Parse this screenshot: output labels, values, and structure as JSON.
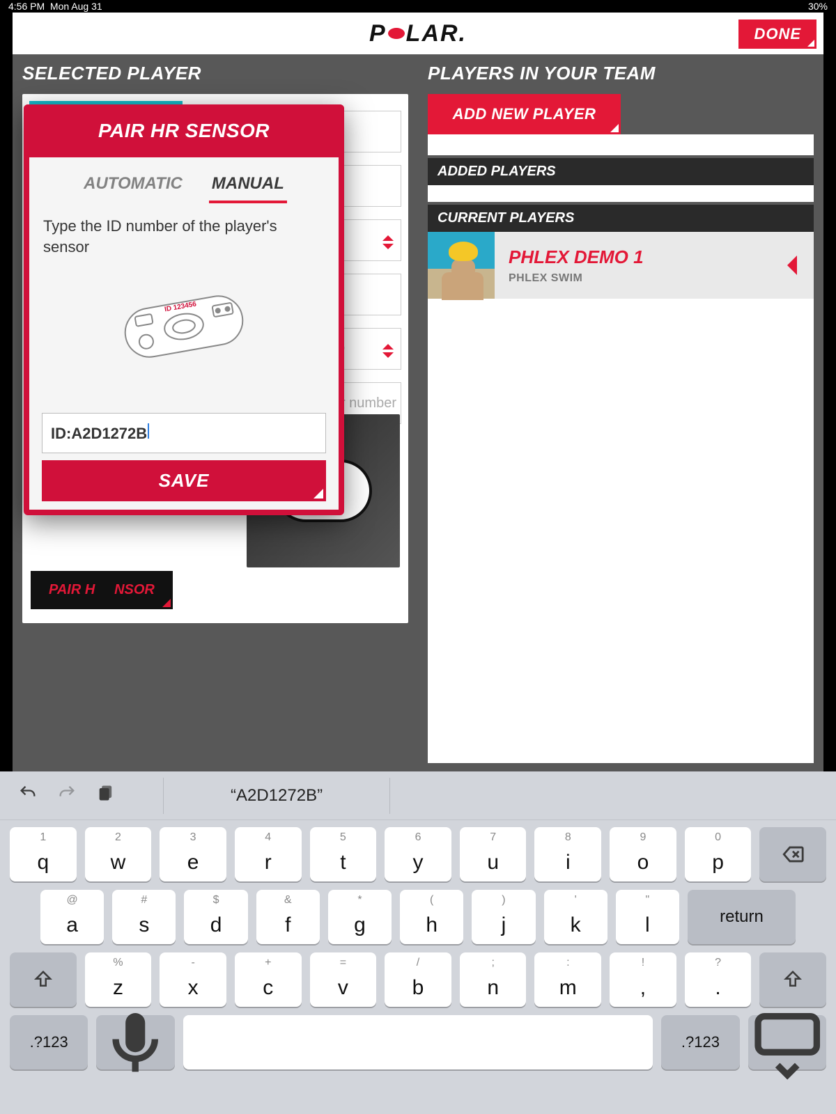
{
  "status": {
    "time": "4:56 PM",
    "date": "Mon Aug 31",
    "battery": "30%"
  },
  "brand": {
    "left": "P",
    "right": "LAR."
  },
  "done": "DONE",
  "left": {
    "title": "SELECTED PLAYER",
    "placeholder_number": "er number",
    "pair_button": "PAIR HR SENSOR"
  },
  "right": {
    "title": "PLAYERS IN YOUR TEAM",
    "add_new": "ADD NEW PLAYER",
    "added_header": "ADDED PLAYERS",
    "current_header": "CURRENT PLAYERS",
    "player": {
      "name": "PHLEX DEMO 1",
      "sub": "PHLEX SWIM"
    }
  },
  "modal": {
    "title": "PAIR HR SENSOR",
    "tab_auto": "AUTOMATIC",
    "tab_manual": "MANUAL",
    "hint": "Type the ID number of the player's sensor",
    "ill_label": "ID 123456",
    "id_value": "ID:A2D1272B",
    "save": "SAVE"
  },
  "keyboard": {
    "suggestion": "“A2D1272B”",
    "row1": [
      {
        "alt": "1",
        "main": "q"
      },
      {
        "alt": "2",
        "main": "w"
      },
      {
        "alt": "3",
        "main": "e"
      },
      {
        "alt": "4",
        "main": "r"
      },
      {
        "alt": "5",
        "main": "t"
      },
      {
        "alt": "6",
        "main": "y"
      },
      {
        "alt": "7",
        "main": "u"
      },
      {
        "alt": "8",
        "main": "i"
      },
      {
        "alt": "9",
        "main": "o"
      },
      {
        "alt": "0",
        "main": "p"
      }
    ],
    "row2": [
      {
        "alt": "@",
        "main": "a"
      },
      {
        "alt": "#",
        "main": "s"
      },
      {
        "alt": "$",
        "main": "d"
      },
      {
        "alt": "&",
        "main": "f"
      },
      {
        "alt": "*",
        "main": "g"
      },
      {
        "alt": "(",
        "main": "h"
      },
      {
        "alt": ")",
        "main": "j"
      },
      {
        "alt": "'",
        "main": "k"
      },
      {
        "alt": "\"",
        "main": "l"
      }
    ],
    "row3": [
      {
        "alt": "%",
        "main": "z"
      },
      {
        "alt": "-",
        "main": "x"
      },
      {
        "alt": "+",
        "main": "c"
      },
      {
        "alt": "=",
        "main": "v"
      },
      {
        "alt": "/",
        "main": "b"
      },
      {
        "alt": ";",
        "main": "n"
      },
      {
        "alt": ":",
        "main": "m"
      },
      {
        "alt": "!",
        "main": ","
      },
      {
        "alt": "?",
        "main": "."
      }
    ],
    "return": "return",
    "numkey": ".?123"
  }
}
